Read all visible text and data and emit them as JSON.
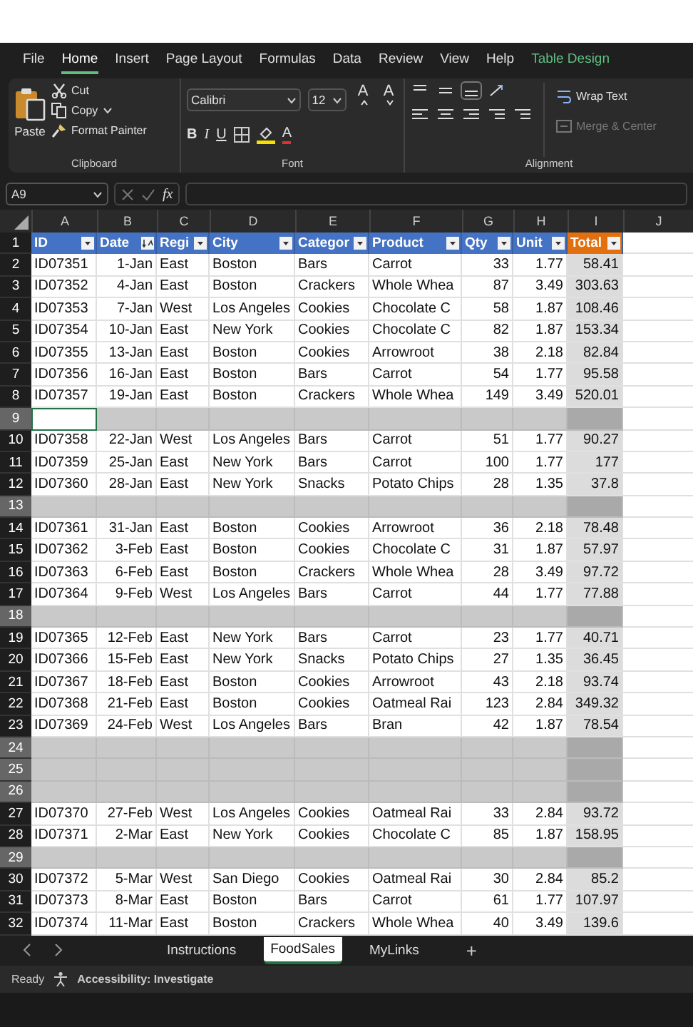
{
  "menu": [
    {
      "label": "File",
      "kind": "normal",
      "selected": false
    },
    {
      "label": "Home",
      "kind": "normal",
      "selected": true
    },
    {
      "label": "Insert",
      "kind": "normal",
      "selected": false
    },
    {
      "label": "Page Layout",
      "kind": "normal",
      "selected": false
    },
    {
      "label": "Formulas",
      "kind": "normal",
      "selected": false
    },
    {
      "label": "Data",
      "kind": "normal",
      "selected": false
    },
    {
      "label": "Review",
      "kind": "normal",
      "selected": false
    },
    {
      "label": "View",
      "kind": "normal",
      "selected": false
    },
    {
      "label": "Help",
      "kind": "normal",
      "selected": false
    },
    {
      "label": "Table Design",
      "kind": "contextual",
      "selected": false
    }
  ],
  "ribbon": {
    "clipboard": {
      "paste": "Paste",
      "cut": "Cut",
      "copy": "Copy",
      "format_painter": "Format Painter",
      "label": "Clipboard"
    },
    "font": {
      "name": "Calibri",
      "size": "12",
      "grow": "A",
      "shrink": "A",
      "bold": "B",
      "italic": "I",
      "underline": "U",
      "font_color": "A",
      "label": "Font"
    },
    "alignment": {
      "wrap_text": "Wrap Text",
      "merge_center": "Merge & Center",
      "merge_disabled": true,
      "label": "Alignment"
    }
  },
  "formula_bar": {
    "name_box": "A9",
    "fx": "fx"
  },
  "sheet": {
    "column_letters": [
      "A",
      "B",
      "C",
      "D",
      "E",
      "F",
      "G",
      "H",
      "I",
      "J"
    ],
    "rows": [
      {
        "number": "1",
        "kind": "header",
        "selected": false,
        "active": false
      },
      {
        "number": "2",
        "kind": "data",
        "selected": false,
        "active": false,
        "cells": [
          "ID07351",
          "1-Jan",
          "East",
          "Boston",
          "Bars",
          "Carrot",
          "33",
          "1.77",
          "58.41"
        ]
      },
      {
        "number": "3",
        "kind": "data",
        "selected": false,
        "active": false,
        "cells": [
          "ID07352",
          "4-Jan",
          "East",
          "Boston",
          "Crackers",
          "Whole Whea",
          "87",
          "3.49",
          "303.63"
        ]
      },
      {
        "number": "4",
        "kind": "data",
        "selected": false,
        "active": false,
        "cells": [
          "ID07353",
          "7-Jan",
          "West",
          "Los Angeles",
          "Cookies",
          "Chocolate C",
          "58",
          "1.87",
          "108.46"
        ]
      },
      {
        "number": "5",
        "kind": "data",
        "selected": false,
        "active": false,
        "cells": [
          "ID07354",
          "10-Jan",
          "East",
          "New York",
          "Cookies",
          "Chocolate C",
          "82",
          "1.87",
          "153.34"
        ]
      },
      {
        "number": "6",
        "kind": "data",
        "selected": false,
        "active": false,
        "cells": [
          "ID07355",
          "13-Jan",
          "East",
          "Boston",
          "Cookies",
          "Arrowroot",
          "38",
          "2.18",
          "82.84"
        ]
      },
      {
        "number": "7",
        "kind": "data",
        "selected": false,
        "active": false,
        "cells": [
          "ID07356",
          "16-Jan",
          "East",
          "Boston",
          "Bars",
          "Carrot",
          "54",
          "1.77",
          "95.58"
        ]
      },
      {
        "number": "8",
        "kind": "data",
        "selected": false,
        "active": false,
        "cells": [
          "ID07357",
          "19-Jan",
          "East",
          "Boston",
          "Crackers",
          "Whole Whea",
          "149",
          "3.49",
          "520.01"
        ]
      },
      {
        "number": "9",
        "kind": "blank",
        "selected": true,
        "active": true
      },
      {
        "number": "10",
        "kind": "data",
        "selected": false,
        "active": false,
        "cells": [
          "ID07358",
          "22-Jan",
          "West",
          "Los Angeles",
          "Bars",
          "Carrot",
          "51",
          "1.77",
          "90.27"
        ]
      },
      {
        "number": "11",
        "kind": "data",
        "selected": false,
        "active": false,
        "cells": [
          "ID07359",
          "25-Jan",
          "East",
          "New York",
          "Bars",
          "Carrot",
          "100",
          "1.77",
          "177"
        ]
      },
      {
        "number": "12",
        "kind": "data",
        "selected": false,
        "active": false,
        "cells": [
          "ID07360",
          "28-Jan",
          "East",
          "New York",
          "Snacks",
          "Potato Chips",
          "28",
          "1.35",
          "37.8"
        ]
      },
      {
        "number": "13",
        "kind": "blank",
        "selected": true,
        "active": false
      },
      {
        "number": "14",
        "kind": "data",
        "selected": false,
        "active": false,
        "cells": [
          "ID07361",
          "31-Jan",
          "East",
          "Boston",
          "Cookies",
          "Arrowroot",
          "36",
          "2.18",
          "78.48"
        ]
      },
      {
        "number": "15",
        "kind": "data",
        "selected": false,
        "active": false,
        "cells": [
          "ID07362",
          "3-Feb",
          "East",
          "Boston",
          "Cookies",
          "Chocolate C",
          "31",
          "1.87",
          "57.97"
        ]
      },
      {
        "number": "16",
        "kind": "data",
        "selected": false,
        "active": false,
        "cells": [
          "ID07363",
          "6-Feb",
          "East",
          "Boston",
          "Crackers",
          "Whole Whea",
          "28",
          "3.49",
          "97.72"
        ]
      },
      {
        "number": "17",
        "kind": "data",
        "selected": false,
        "active": false,
        "cells": [
          "ID07364",
          "9-Feb",
          "West",
          "Los Angeles",
          "Bars",
          "Carrot",
          "44",
          "1.77",
          "77.88"
        ]
      },
      {
        "number": "18",
        "kind": "blank",
        "selected": true,
        "active": false
      },
      {
        "number": "19",
        "kind": "data",
        "selected": false,
        "active": false,
        "cells": [
          "ID07365",
          "12-Feb",
          "East",
          "New York",
          "Bars",
          "Carrot",
          "23",
          "1.77",
          "40.71"
        ]
      },
      {
        "number": "20",
        "kind": "data",
        "selected": false,
        "active": false,
        "cells": [
          "ID07366",
          "15-Feb",
          "East",
          "New York",
          "Snacks",
          "Potato Chips",
          "27",
          "1.35",
          "36.45"
        ]
      },
      {
        "number": "21",
        "kind": "data",
        "selected": false,
        "active": false,
        "cells": [
          "ID07367",
          "18-Feb",
          "East",
          "Boston",
          "Cookies",
          "Arrowroot",
          "43",
          "2.18",
          "93.74"
        ]
      },
      {
        "number": "22",
        "kind": "data",
        "selected": false,
        "active": false,
        "cells": [
          "ID07368",
          "21-Feb",
          "East",
          "Boston",
          "Cookies",
          "Oatmeal Rai",
          "123",
          "2.84",
          "349.32"
        ]
      },
      {
        "number": "23",
        "kind": "data",
        "selected": false,
        "active": false,
        "cells": [
          "ID07369",
          "24-Feb",
          "West",
          "Los Angeles",
          "Bars",
          "Bran",
          "42",
          "1.87",
          "78.54"
        ]
      },
      {
        "number": "24",
        "kind": "blank",
        "selected": true,
        "active": false
      },
      {
        "number": "25",
        "kind": "blank",
        "selected": true,
        "active": false
      },
      {
        "number": "26",
        "kind": "blank",
        "selected": true,
        "active": false
      },
      {
        "number": "27",
        "kind": "data",
        "selected": false,
        "active": false,
        "cells": [
          "ID07370",
          "27-Feb",
          "West",
          "Los Angeles",
          "Cookies",
          "Oatmeal Rai",
          "33",
          "2.84",
          "93.72"
        ]
      },
      {
        "number": "28",
        "kind": "data",
        "selected": false,
        "active": false,
        "cells": [
          "ID07371",
          "2-Mar",
          "East",
          "New York",
          "Cookies",
          "Chocolate C",
          "85",
          "1.87",
          "158.95"
        ]
      },
      {
        "number": "29",
        "kind": "blank",
        "selected": true,
        "active": false
      },
      {
        "number": "30",
        "kind": "data",
        "selected": false,
        "active": false,
        "cells": [
          "ID07372",
          "5-Mar",
          "West",
          "San Diego",
          "Cookies",
          "Oatmeal Rai",
          "30",
          "2.84",
          "85.2"
        ]
      },
      {
        "number": "31",
        "kind": "data",
        "selected": false,
        "active": false,
        "cells": [
          "ID07373",
          "8-Mar",
          "East",
          "Boston",
          "Bars",
          "Carrot",
          "61",
          "1.77",
          "107.97"
        ]
      },
      {
        "number": "32",
        "kind": "data",
        "selected": false,
        "active": false,
        "cells": [
          "ID07374",
          "11-Mar",
          "East",
          "Boston",
          "Crackers",
          "Whole Whea",
          "40",
          "3.49",
          "139.6"
        ]
      }
    ]
  },
  "table": {
    "columns": [
      {
        "label": "ID",
        "kind": "text",
        "color": "#4472c4",
        "sorted": false
      },
      {
        "label": "Date",
        "kind": "number",
        "color": "#4472c4",
        "sorted": true
      },
      {
        "label": "Regi",
        "kind": "text",
        "color": "#4472c4",
        "sorted": false
      },
      {
        "label": "City",
        "kind": "text",
        "color": "#4472c4",
        "sorted": false
      },
      {
        "label": "Categor",
        "kind": "text",
        "color": "#4472c4",
        "sorted": false
      },
      {
        "label": "Product",
        "kind": "text",
        "color": "#4472c4",
        "sorted": false
      },
      {
        "label": "Qty",
        "kind": "number",
        "color": "#4472c4",
        "sorted": false
      },
      {
        "label": "Unit",
        "kind": "number",
        "color": "#4472c4",
        "sorted": false
      },
      {
        "label": "Total",
        "kind": "total",
        "color": "#e2700f",
        "sorted": false
      }
    ]
  },
  "sheet_tabs": [
    {
      "label": "Instructions",
      "selected": false
    },
    {
      "label": "FoodSales",
      "selected": true
    },
    {
      "label": "MyLinks",
      "selected": false
    }
  ],
  "add_sheet": "+",
  "status_bar": {
    "ready": "Ready",
    "accessibility": "Accessibility: Investigate"
  }
}
